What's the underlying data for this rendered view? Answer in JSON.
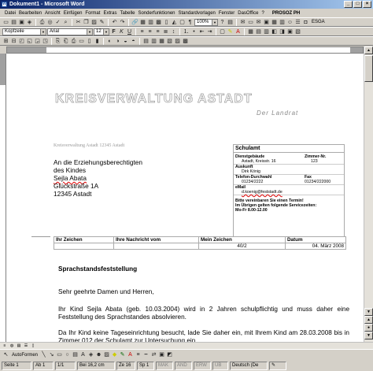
{
  "window": {
    "title": "Dokument1 - Microsoft Word"
  },
  "menu": {
    "items": [
      "Datei",
      "Bearbeiten",
      "Ansicht",
      "Einfügen",
      "Format",
      "Extras",
      "Tabelle",
      "Sonderfunktionen",
      "Standardvorlagen",
      "Fenster",
      "DasOffice",
      "?"
    ],
    "brand": "PROSOZ PH"
  },
  "toolbar": {
    "zoom": "100%",
    "style": "Kopfzeile",
    "font": "Arial",
    "size": "12",
    "esga": "ESGA"
  },
  "letter": {
    "header": "KREISVERWALTUNG ASTADT",
    "subheader": "Der Landrat",
    "sender_line": "Kreisverwaltung Astadt 12345 Astadt",
    "recipient": [
      "An die Erziehungsberechtigten",
      "des Kindes",
      "Sejla Abata",
      "Glückstraße 1A",
      "12345 Astadt"
    ],
    "infobox": {
      "title": "Schulamt",
      "dienst_label": "Dienstgebäude",
      "zimmer_label": "Zimmer-Nr.",
      "dienst_value": "Astadt, Kreisstr. 16",
      "zimmer_value": "123",
      "auskunft_label": "Auskunft",
      "auskunft_value": "Dirk König",
      "telefon_label": "Telefon-Durchwahl",
      "fax_label": "Fax",
      "telefon_value": "01234/2222",
      "fax_value": "01234/222000",
      "email_label": "eMail",
      "email_value": "d.koenig@feststadt.de",
      "note": [
        "Bitte vereinbaren Sie einen Termin!",
        "Im Übrigen gelten folgende Servicezeiten:",
        "Mo-Fr 8.00-12.00"
      ]
    },
    "ref_table": {
      "headers": [
        "Ihr Zeichen",
        "Ihre Nachricht vom",
        "Mein Zeichen",
        "Datum"
      ],
      "values": [
        "",
        "",
        "40/2",
        "04. März 2008"
      ]
    },
    "subject": "Sprachstandsfeststellung",
    "salutation": "Sehr geehrte Damen und Herren,",
    "paragraph1": "Ihr Kind Sejla Abata (geb. 10.03.2004) wird in 2 Jahren schulpflichtig und muss daher eine Feststellung des Sprachstandes absolvieren.",
    "paragraph2": "Da Ihr Kind keine Tageseinrichtung besucht, lade Sie daher ein, mit Ihrem Kind am 28.03.2008 bis in Zimmer 012 der Schulamt zur Untersuchung ein"
  },
  "drawing": {
    "autoshapes": "AutoFormen"
  },
  "status": {
    "page": "Seite 1",
    "section": "Ab 1",
    "pages": "1/1",
    "position": "Bei 16,2 cm",
    "line": "Ze 16",
    "column": "Sp 1",
    "mak": "MAK",
    "aend": "ÄND",
    "erw": "ERW",
    "ub": "ÜB",
    "lang": "Deutsch (De"
  }
}
